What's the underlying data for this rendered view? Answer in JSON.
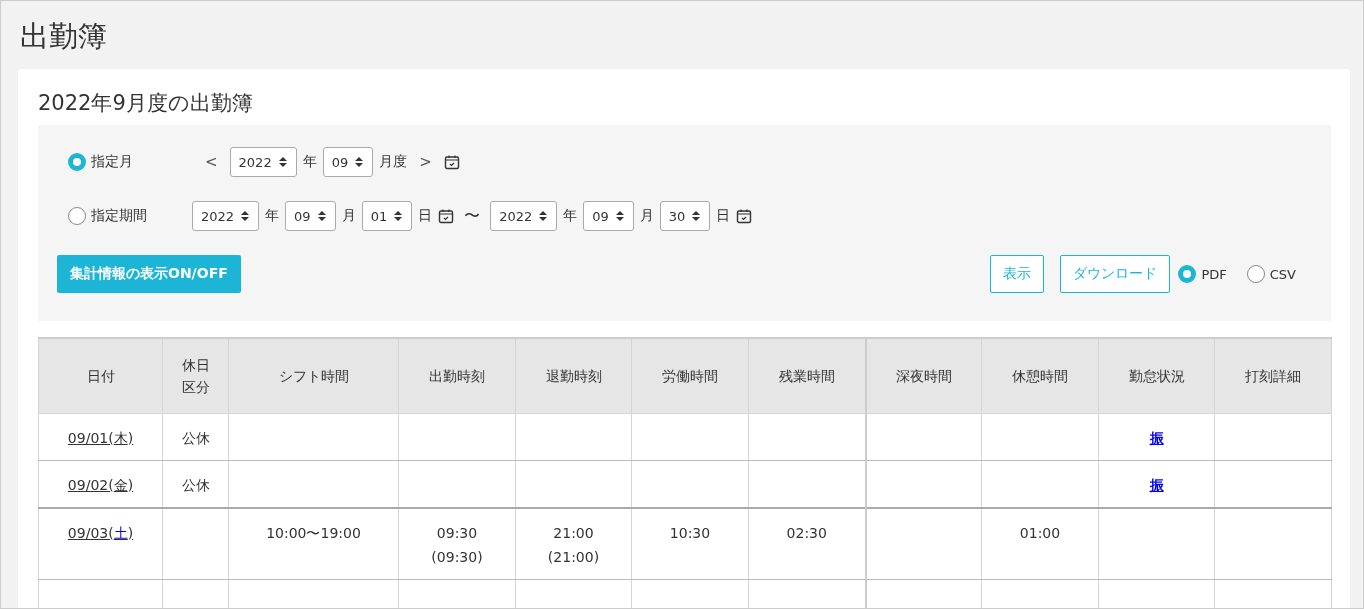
{
  "page_title": "出勤簿",
  "card_title": "2022年9月度の出勤簿",
  "filter": {
    "month_mode": {
      "label": "指定月",
      "selected": true,
      "prev": "<",
      "year": "2022",
      "year_unit": "年",
      "month": "09",
      "month_unit": "月度",
      "next": ">"
    },
    "period_mode": {
      "label": "指定期間",
      "selected": false,
      "from": {
        "year": "2022",
        "year_unit": "年",
        "month": "09",
        "month_unit": "月",
        "day": "01",
        "day_unit": "日"
      },
      "separator": "〜",
      "to": {
        "year": "2022",
        "year_unit": "年",
        "month": "09",
        "month_unit": "月",
        "day": "30",
        "day_unit": "日"
      }
    },
    "toggle_button": "集計情報の表示ON/OFF",
    "show_button": "表示",
    "download_button": "ダウンロード",
    "formats": [
      {
        "label": "PDF",
        "selected": true
      },
      {
        "label": "CSV",
        "selected": false
      }
    ]
  },
  "table": {
    "columns": [
      "日付",
      "休日区分",
      "シフト時間",
      "出勤時刻",
      "退勤時刻",
      "労働時間",
      "残業時間",
      "深夜時間",
      "休憩時間",
      "勤怠状況",
      "打刻詳細"
    ],
    "rows": [
      {
        "date": "09/01(",
        "weekday": "木",
        "date_end": ")",
        "color": "#333333",
        "holiday": "公休",
        "status": "振"
      },
      {
        "date": "09/02(",
        "weekday": "金",
        "date_end": ")",
        "color": "#333333",
        "holiday": "公休",
        "status": "振"
      },
      {
        "date": "09/03(",
        "weekday": "土",
        "date_end": ")",
        "color": "#0000ee",
        "shift": "10:00〜19:00",
        "clock_in": "09:30\n(09:30)",
        "clock_out": "21:00\n(21:00)",
        "work": "10:30",
        "overtime": "02:30",
        "break": "01:00"
      },
      {}
    ]
  }
}
